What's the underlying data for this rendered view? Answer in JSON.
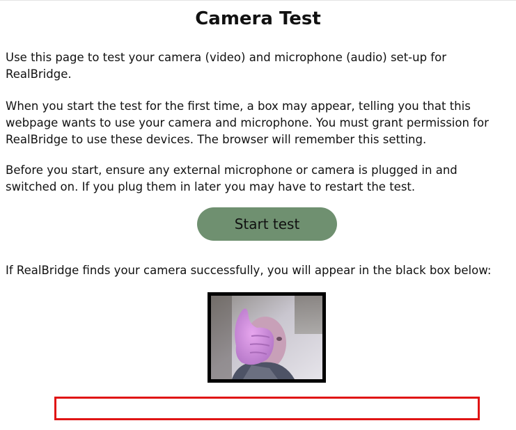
{
  "page": {
    "title": "Camera Test",
    "intro": "Use this page to test your camera (video) and microphone (audio) set-up for RealBridge.",
    "permission_note": "When you start the test for the first time, a box may appear, telling you that this webpage wants to use your camera and microphone. You must grant permission for RealBridge to use these devices. The browser will remember this setting.",
    "before_start_note": "Before you start, ensure any external microphone or camera is plugged in and switched on. If you plug them in later you may have to restart the test.",
    "start_button_label": "Start test",
    "camera_found_note": "If RealBridge finds your camera successfully, you will appear in the black box below:"
  },
  "colors": {
    "button_bg": "#6f9070",
    "video_frame": "#000000",
    "result_border": "#e01414"
  }
}
